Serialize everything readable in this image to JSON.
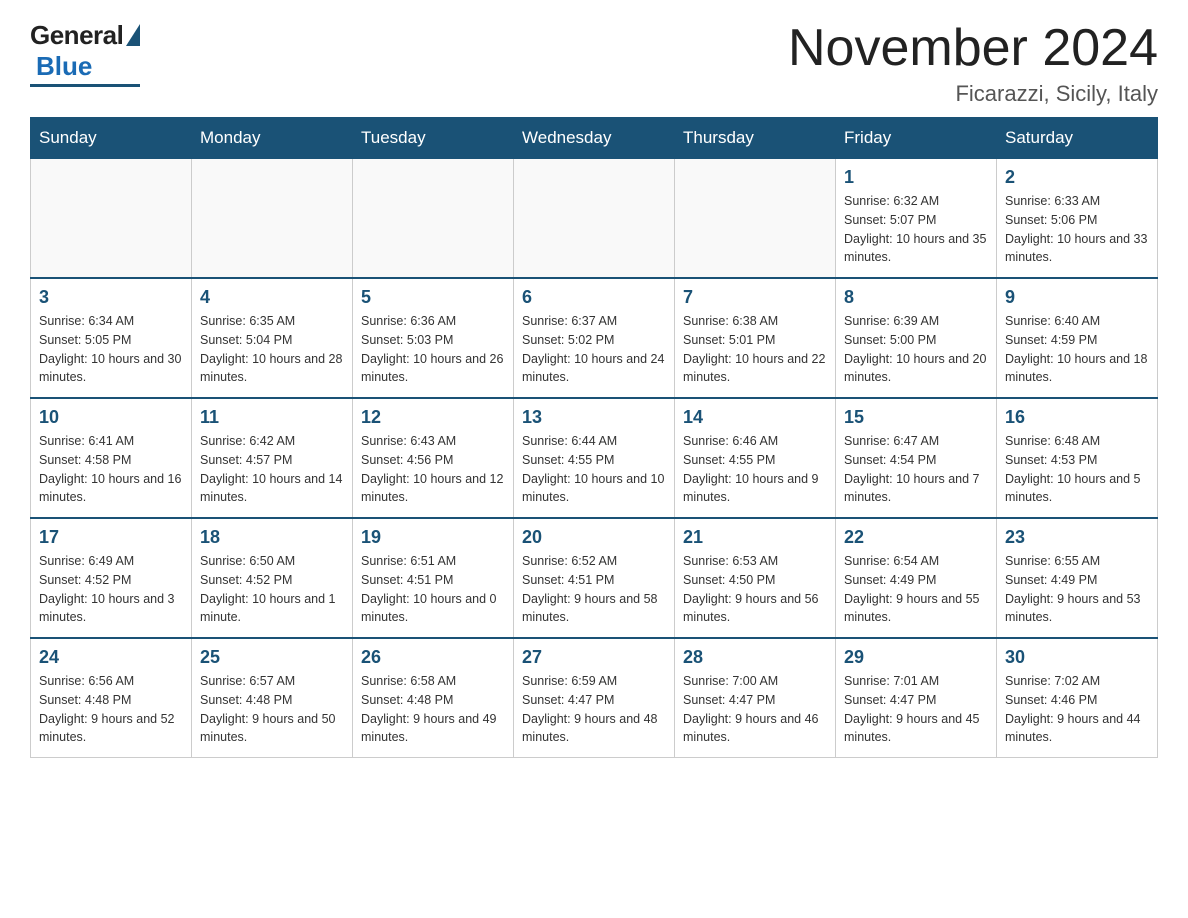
{
  "logo": {
    "general": "General",
    "blue": "Blue"
  },
  "header": {
    "month": "November 2024",
    "location": "Ficarazzi, Sicily, Italy"
  },
  "weekdays": [
    "Sunday",
    "Monday",
    "Tuesday",
    "Wednesday",
    "Thursday",
    "Friday",
    "Saturday"
  ],
  "weeks": [
    [
      {
        "day": "",
        "info": ""
      },
      {
        "day": "",
        "info": ""
      },
      {
        "day": "",
        "info": ""
      },
      {
        "day": "",
        "info": ""
      },
      {
        "day": "",
        "info": ""
      },
      {
        "day": "1",
        "info": "Sunrise: 6:32 AM\nSunset: 5:07 PM\nDaylight: 10 hours and 35 minutes."
      },
      {
        "day": "2",
        "info": "Sunrise: 6:33 AM\nSunset: 5:06 PM\nDaylight: 10 hours and 33 minutes."
      }
    ],
    [
      {
        "day": "3",
        "info": "Sunrise: 6:34 AM\nSunset: 5:05 PM\nDaylight: 10 hours and 30 minutes."
      },
      {
        "day": "4",
        "info": "Sunrise: 6:35 AM\nSunset: 5:04 PM\nDaylight: 10 hours and 28 minutes."
      },
      {
        "day": "5",
        "info": "Sunrise: 6:36 AM\nSunset: 5:03 PM\nDaylight: 10 hours and 26 minutes."
      },
      {
        "day": "6",
        "info": "Sunrise: 6:37 AM\nSunset: 5:02 PM\nDaylight: 10 hours and 24 minutes."
      },
      {
        "day": "7",
        "info": "Sunrise: 6:38 AM\nSunset: 5:01 PM\nDaylight: 10 hours and 22 minutes."
      },
      {
        "day": "8",
        "info": "Sunrise: 6:39 AM\nSunset: 5:00 PM\nDaylight: 10 hours and 20 minutes."
      },
      {
        "day": "9",
        "info": "Sunrise: 6:40 AM\nSunset: 4:59 PM\nDaylight: 10 hours and 18 minutes."
      }
    ],
    [
      {
        "day": "10",
        "info": "Sunrise: 6:41 AM\nSunset: 4:58 PM\nDaylight: 10 hours and 16 minutes."
      },
      {
        "day": "11",
        "info": "Sunrise: 6:42 AM\nSunset: 4:57 PM\nDaylight: 10 hours and 14 minutes."
      },
      {
        "day": "12",
        "info": "Sunrise: 6:43 AM\nSunset: 4:56 PM\nDaylight: 10 hours and 12 minutes."
      },
      {
        "day": "13",
        "info": "Sunrise: 6:44 AM\nSunset: 4:55 PM\nDaylight: 10 hours and 10 minutes."
      },
      {
        "day": "14",
        "info": "Sunrise: 6:46 AM\nSunset: 4:55 PM\nDaylight: 10 hours and 9 minutes."
      },
      {
        "day": "15",
        "info": "Sunrise: 6:47 AM\nSunset: 4:54 PM\nDaylight: 10 hours and 7 minutes."
      },
      {
        "day": "16",
        "info": "Sunrise: 6:48 AM\nSunset: 4:53 PM\nDaylight: 10 hours and 5 minutes."
      }
    ],
    [
      {
        "day": "17",
        "info": "Sunrise: 6:49 AM\nSunset: 4:52 PM\nDaylight: 10 hours and 3 minutes."
      },
      {
        "day": "18",
        "info": "Sunrise: 6:50 AM\nSunset: 4:52 PM\nDaylight: 10 hours and 1 minute."
      },
      {
        "day": "19",
        "info": "Sunrise: 6:51 AM\nSunset: 4:51 PM\nDaylight: 10 hours and 0 minutes."
      },
      {
        "day": "20",
        "info": "Sunrise: 6:52 AM\nSunset: 4:51 PM\nDaylight: 9 hours and 58 minutes."
      },
      {
        "day": "21",
        "info": "Sunrise: 6:53 AM\nSunset: 4:50 PM\nDaylight: 9 hours and 56 minutes."
      },
      {
        "day": "22",
        "info": "Sunrise: 6:54 AM\nSunset: 4:49 PM\nDaylight: 9 hours and 55 minutes."
      },
      {
        "day": "23",
        "info": "Sunrise: 6:55 AM\nSunset: 4:49 PM\nDaylight: 9 hours and 53 minutes."
      }
    ],
    [
      {
        "day": "24",
        "info": "Sunrise: 6:56 AM\nSunset: 4:48 PM\nDaylight: 9 hours and 52 minutes."
      },
      {
        "day": "25",
        "info": "Sunrise: 6:57 AM\nSunset: 4:48 PM\nDaylight: 9 hours and 50 minutes."
      },
      {
        "day": "26",
        "info": "Sunrise: 6:58 AM\nSunset: 4:48 PM\nDaylight: 9 hours and 49 minutes."
      },
      {
        "day": "27",
        "info": "Sunrise: 6:59 AM\nSunset: 4:47 PM\nDaylight: 9 hours and 48 minutes."
      },
      {
        "day": "28",
        "info": "Sunrise: 7:00 AM\nSunset: 4:47 PM\nDaylight: 9 hours and 46 minutes."
      },
      {
        "day": "29",
        "info": "Sunrise: 7:01 AM\nSunset: 4:47 PM\nDaylight: 9 hours and 45 minutes."
      },
      {
        "day": "30",
        "info": "Sunrise: 7:02 AM\nSunset: 4:46 PM\nDaylight: 9 hours and 44 minutes."
      }
    ]
  ]
}
